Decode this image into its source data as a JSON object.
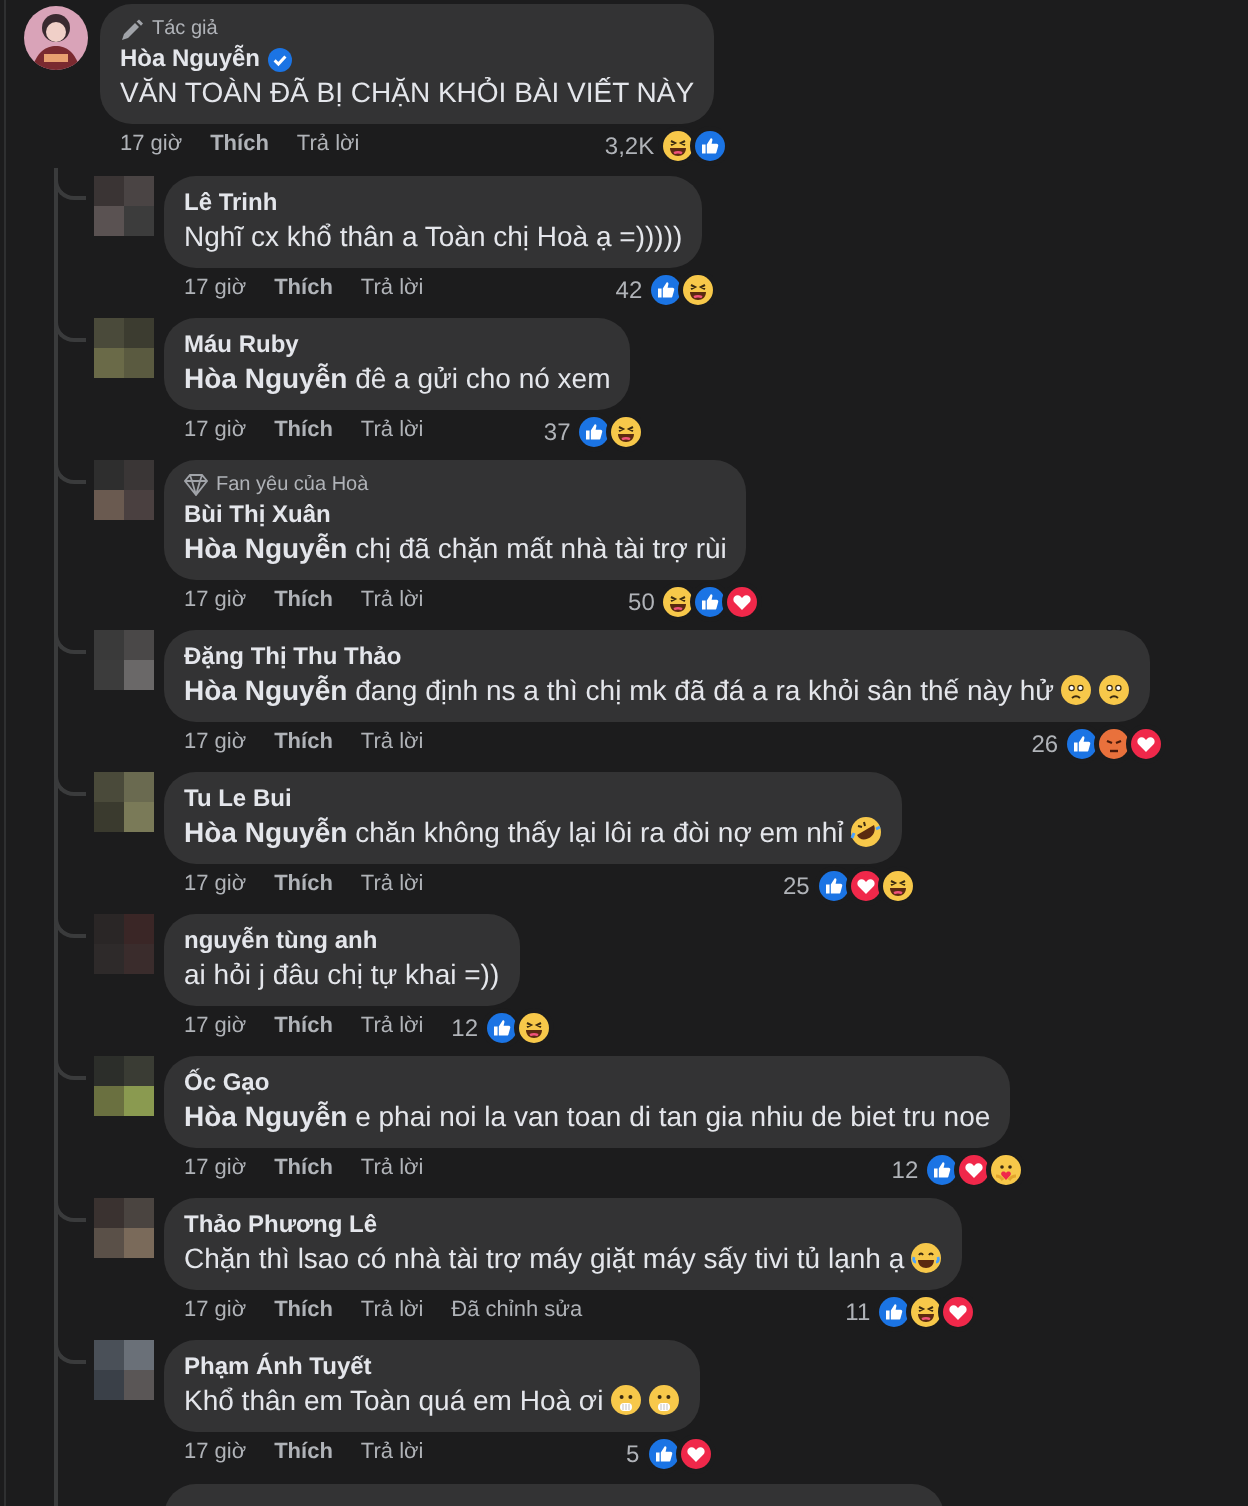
{
  "comment": {
    "badge": "Tác giả",
    "author": "Hòa Nguyễn",
    "verified": true,
    "text": "VĂN TOÀN ĐÃ BỊ CHẶN KHỎI BÀI VIẾT NÀY",
    "time": "17 giờ",
    "like": "Thích",
    "reply": "Trả lời",
    "reaction_count": "3,2K",
    "reactions": [
      {
        "kind": "haha"
      },
      {
        "kind": "like"
      }
    ]
  },
  "replies": [
    {
      "kind": "comment",
      "author": "Lê Trinh",
      "text": "Nghĩ cx khổ thân a Toàn chị Hoà ạ =)))))",
      "time": "17 giờ",
      "like": "Thích",
      "reply": "Trả lời",
      "reaction_count": "42",
      "reactions": [
        {
          "kind": "like"
        },
        {
          "kind": "haha"
        }
      ]
    },
    {
      "kind": "comment",
      "author": "Máu Ruby",
      "text": "**Hòa Nguyễn** đê a gửi cho nó xem",
      "time": "17 giờ",
      "like": "Thích",
      "reply": "Trả lời",
      "reaction_count": "37",
      "reactions": [
        {
          "kind": "like"
        },
        {
          "kind": "haha"
        }
      ]
    },
    {
      "kind": "comment",
      "badge": "Fan yêu của Hoà",
      "author": "Bùi Thị Xuân",
      "text": "**Hòa Nguyễn** chị đã chặn mất nhà tài trợ rùi",
      "time": "17 giờ",
      "like": "Thích",
      "reply": "Trả lời",
      "reaction_count": "50",
      "reactions": [
        {
          "kind": "haha"
        },
        {
          "kind": "like"
        },
        {
          "kind": "love"
        }
      ]
    },
    {
      "kind": "comment",
      "author": "Đặng Thị Thu Thảo",
      "text": "**Hòa Nguyễn** đang định ns a thì chị mk đã đá a ra khỏi sân thế này hử",
      "emoji": [
        {
          "kind": "worried"
        },
        {
          "kind": "worried"
        }
      ],
      "time": "17 giờ",
      "like": "Thích",
      "reply": "Trả lời",
      "reaction_count": "26",
      "reactions": [
        {
          "kind": "like"
        },
        {
          "kind": "angry"
        },
        {
          "kind": "love"
        }
      ]
    },
    {
      "kind": "comment",
      "author": "Tu Le Bui",
      "text": "**Hòa Nguyễn** chăn không thấy lại lôi ra đòi nợ em nhỉ",
      "emoji": [
        {
          "kind": "rofl"
        }
      ],
      "time": "17 giờ",
      "like": "Thích",
      "reply": "Trả lời",
      "reaction_count": "25",
      "reactions": [
        {
          "kind": "like"
        },
        {
          "kind": "love"
        },
        {
          "kind": "haha"
        }
      ]
    },
    {
      "kind": "comment",
      "author": "nguyễn tùng anh",
      "text": "ai hỏi j đâu chị tự khai =))",
      "time": "17 giờ",
      "like": "Thích",
      "reply": "Trả lời",
      "reaction_count": "12",
      "reactions": [
        {
          "kind": "like"
        },
        {
          "kind": "haha"
        }
      ]
    },
    {
      "kind": "comment",
      "author": "Ốc Gạo",
      "text": "**Hòa Nguyễn** e phai noi la van toan di tan gia nhiu de biet tru noe",
      "time": "17 giờ",
      "like": "Thích",
      "reply": "Trả lời",
      "reaction_count": "12",
      "reactions": [
        {
          "kind": "like"
        },
        {
          "kind": "love"
        },
        {
          "kind": "care"
        }
      ]
    },
    {
      "kind": "comment",
      "author": "Thảo Phương Lê",
      "text": "Chặn thì lsao có nhà tài trợ máy giặt máy sấy tivi tủ lạnh ạ",
      "emoji": [
        {
          "kind": "tears"
        }
      ],
      "time": "17 giờ",
      "like": "Thích",
      "reply": "Trả lời",
      "edited": "Đã chỉnh sửa",
      "reaction_count": "11",
      "reactions": [
        {
          "kind": "like"
        },
        {
          "kind": "haha"
        },
        {
          "kind": "love"
        }
      ]
    },
    {
      "kind": "comment",
      "author": "Phạm Ánh Tuyết",
      "text": "Khổ thân em Toàn quá em Hoà ơi",
      "emoji": [
        {
          "kind": "gasp"
        },
        {
          "kind": "gasp"
        }
      ],
      "time": "17 giờ",
      "like": "Thích",
      "reply": "Trả lời",
      "reaction_count": "5",
      "reactions": [
        {
          "kind": "like"
        },
        {
          "kind": "love"
        }
      ]
    },
    {
      "kind": "cut"
    }
  ]
}
